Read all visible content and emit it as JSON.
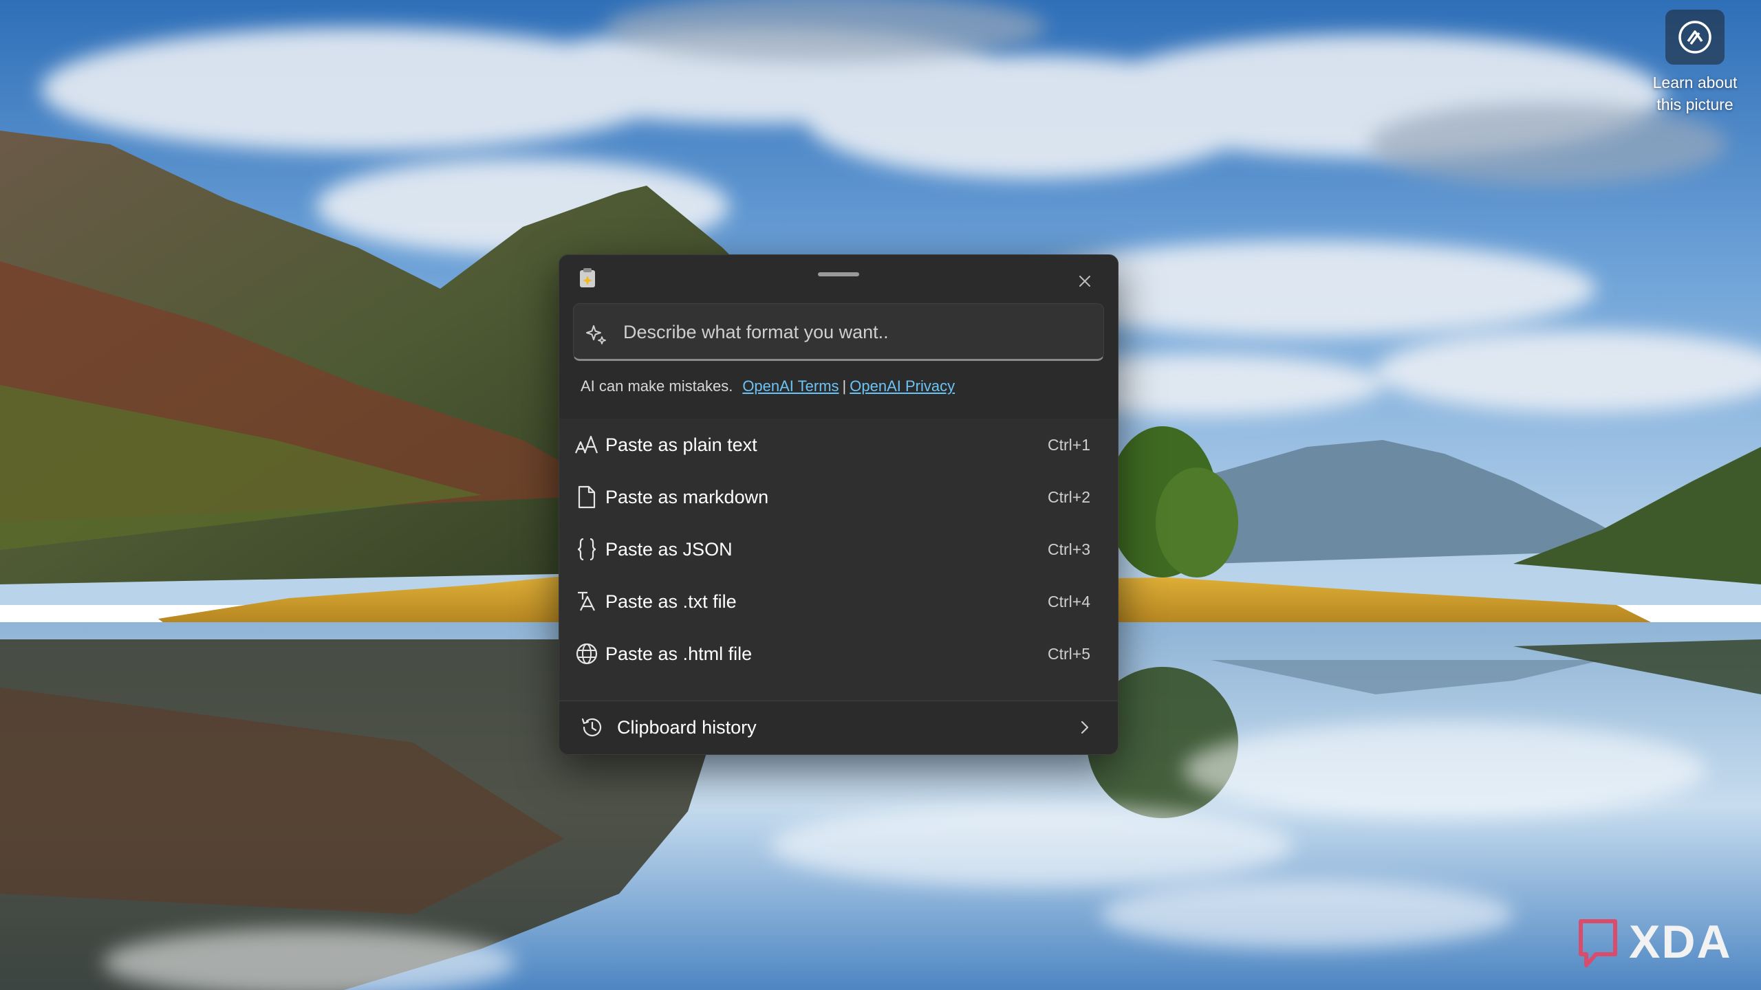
{
  "desktop": {
    "learn_about_picture": {
      "line1": "Learn about",
      "line2": "this picture",
      "icon": "camera-info-icon"
    },
    "watermark": "XDA"
  },
  "advanced_paste": {
    "app_icon": "clipboard-sparkle-icon",
    "close_icon": "close-icon",
    "prompt": {
      "placeholder": "Describe what format you want..",
      "value": "",
      "icon": "sparkle-icon"
    },
    "disclaimer": {
      "text": "AI can make mistakes.",
      "terms_link": "OpenAI Terms",
      "separator": "|",
      "privacy_link": "OpenAI Privacy"
    },
    "options": [
      {
        "label": "Paste as plain text",
        "shortcut": "Ctrl+1",
        "icon": "font-size-icon"
      },
      {
        "label": "Paste as markdown",
        "shortcut": "Ctrl+2",
        "icon": "document-icon"
      },
      {
        "label": "Paste as JSON",
        "shortcut": "Ctrl+3",
        "icon": "braces-icon"
      },
      {
        "label": "Paste as .txt file",
        "shortcut": "Ctrl+4",
        "icon": "text-file-icon"
      },
      {
        "label": "Paste as .html file",
        "shortcut": "Ctrl+5",
        "icon": "globe-icon"
      }
    ],
    "clipboard_history": {
      "label": "Clipboard history",
      "icon": "history-icon",
      "chevron": "chevron-right-icon"
    }
  },
  "colors": {
    "panel_bg": "#2b2b2b",
    "link": "#6cc3f5",
    "text": "#ffffff",
    "muted_text": "#cfcfcf"
  }
}
